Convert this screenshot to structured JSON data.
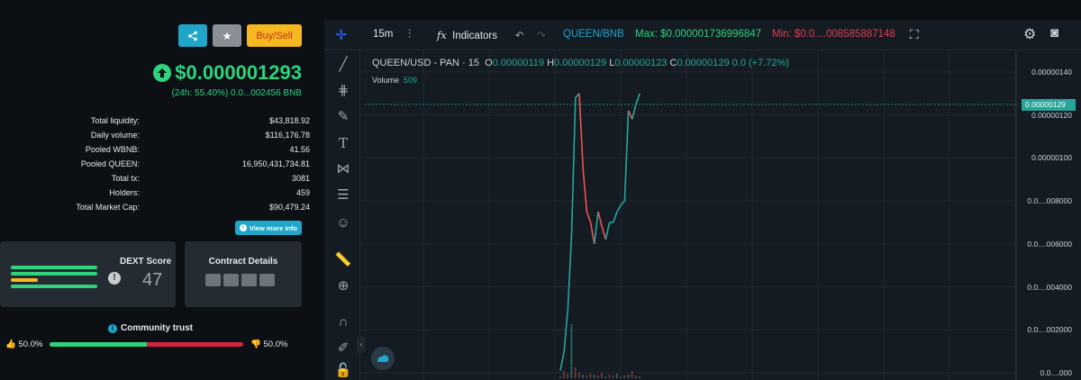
{
  "token": {
    "price": "$0.000001293",
    "change": "(24h: 55.40%) 0.0...002456 BNB",
    "buy_sell_label": "Buy/Sell"
  },
  "stats": [
    {
      "label": "Total liquidity:",
      "value": "$43,818.92"
    },
    {
      "label": "Daily volume:",
      "value": "$116,176.78"
    },
    {
      "label": "Pooled WBNB:",
      "value": "41.56"
    },
    {
      "label": "Pooled QUEEN:",
      "value": "16,950,431,734.81"
    },
    {
      "label": "Total tx:",
      "value": "3081"
    },
    {
      "label": "Holders:",
      "value": "459"
    },
    {
      "label": "Total Market Cap:",
      "value": "$90,479.24"
    }
  ],
  "view_more_label": "View more info",
  "dext": {
    "title": "DEXT Score",
    "score": "47"
  },
  "contract": {
    "title": "Contract Details"
  },
  "community": {
    "title": "Community trust",
    "like": "50.0%",
    "dislike": "50.0%",
    "like_fraction": 0.5
  },
  "chart": {
    "interval": "15m",
    "indicators_label": "Indicators",
    "pair": "QUEEN/BNB",
    "max": "Max: $0.000001736996847",
    "min": "Min: $0.0....008585887148",
    "legend": {
      "symbol": "QUEEN/USD - PAN · 15",
      "o_label": "O",
      "o": "0.00000119",
      "h_label": "H",
      "h": "0.00000129",
      "l_label": "L",
      "l": "0.00000123",
      "c_label": "C",
      "c": "0.00000129",
      "delta": "0.0 (+7.72%)"
    },
    "volume_label": "Volume",
    "volume": "509",
    "current_price_tag": "0.00000129",
    "colors": {
      "up": "#26a69a",
      "down": "#ef5350",
      "bg": "#141b23"
    }
  },
  "chart_data": {
    "type": "line",
    "title": "QUEEN/USD - PAN · 15",
    "y_ticks": [
      "0.00000140",
      "0.00000120",
      "0.00000100",
      "0.0....008000",
      "0.0....006000",
      "0.0....004000",
      "0.0....002000",
      "0.0....000"
    ],
    "y_values": [
      1.4e-06,
      1.2e-06,
      1e-06,
      8e-07,
      6e-07,
      4e-07,
      2e-07,
      0
    ],
    "ylim": [
      0,
      1.5e-06
    ],
    "current": 1.29e-06,
    "series": [
      {
        "name": "Volume",
        "values": [
          1e-08,
          1e-07,
          3e-07,
          6.5e-07,
          1.28e-06,
          1.3e-06,
          9.5e-07,
          7.5e-07,
          7e-07,
          6e-07,
          7.5e-07,
          6.8e-07,
          6.2e-07,
          7e-07,
          7e-07,
          7.5e-07,
          7.8e-07,
          8e-07,
          1.22e-06,
          1.18e-06,
          1.25e-06,
          1.3e-06
        ]
      }
    ]
  }
}
